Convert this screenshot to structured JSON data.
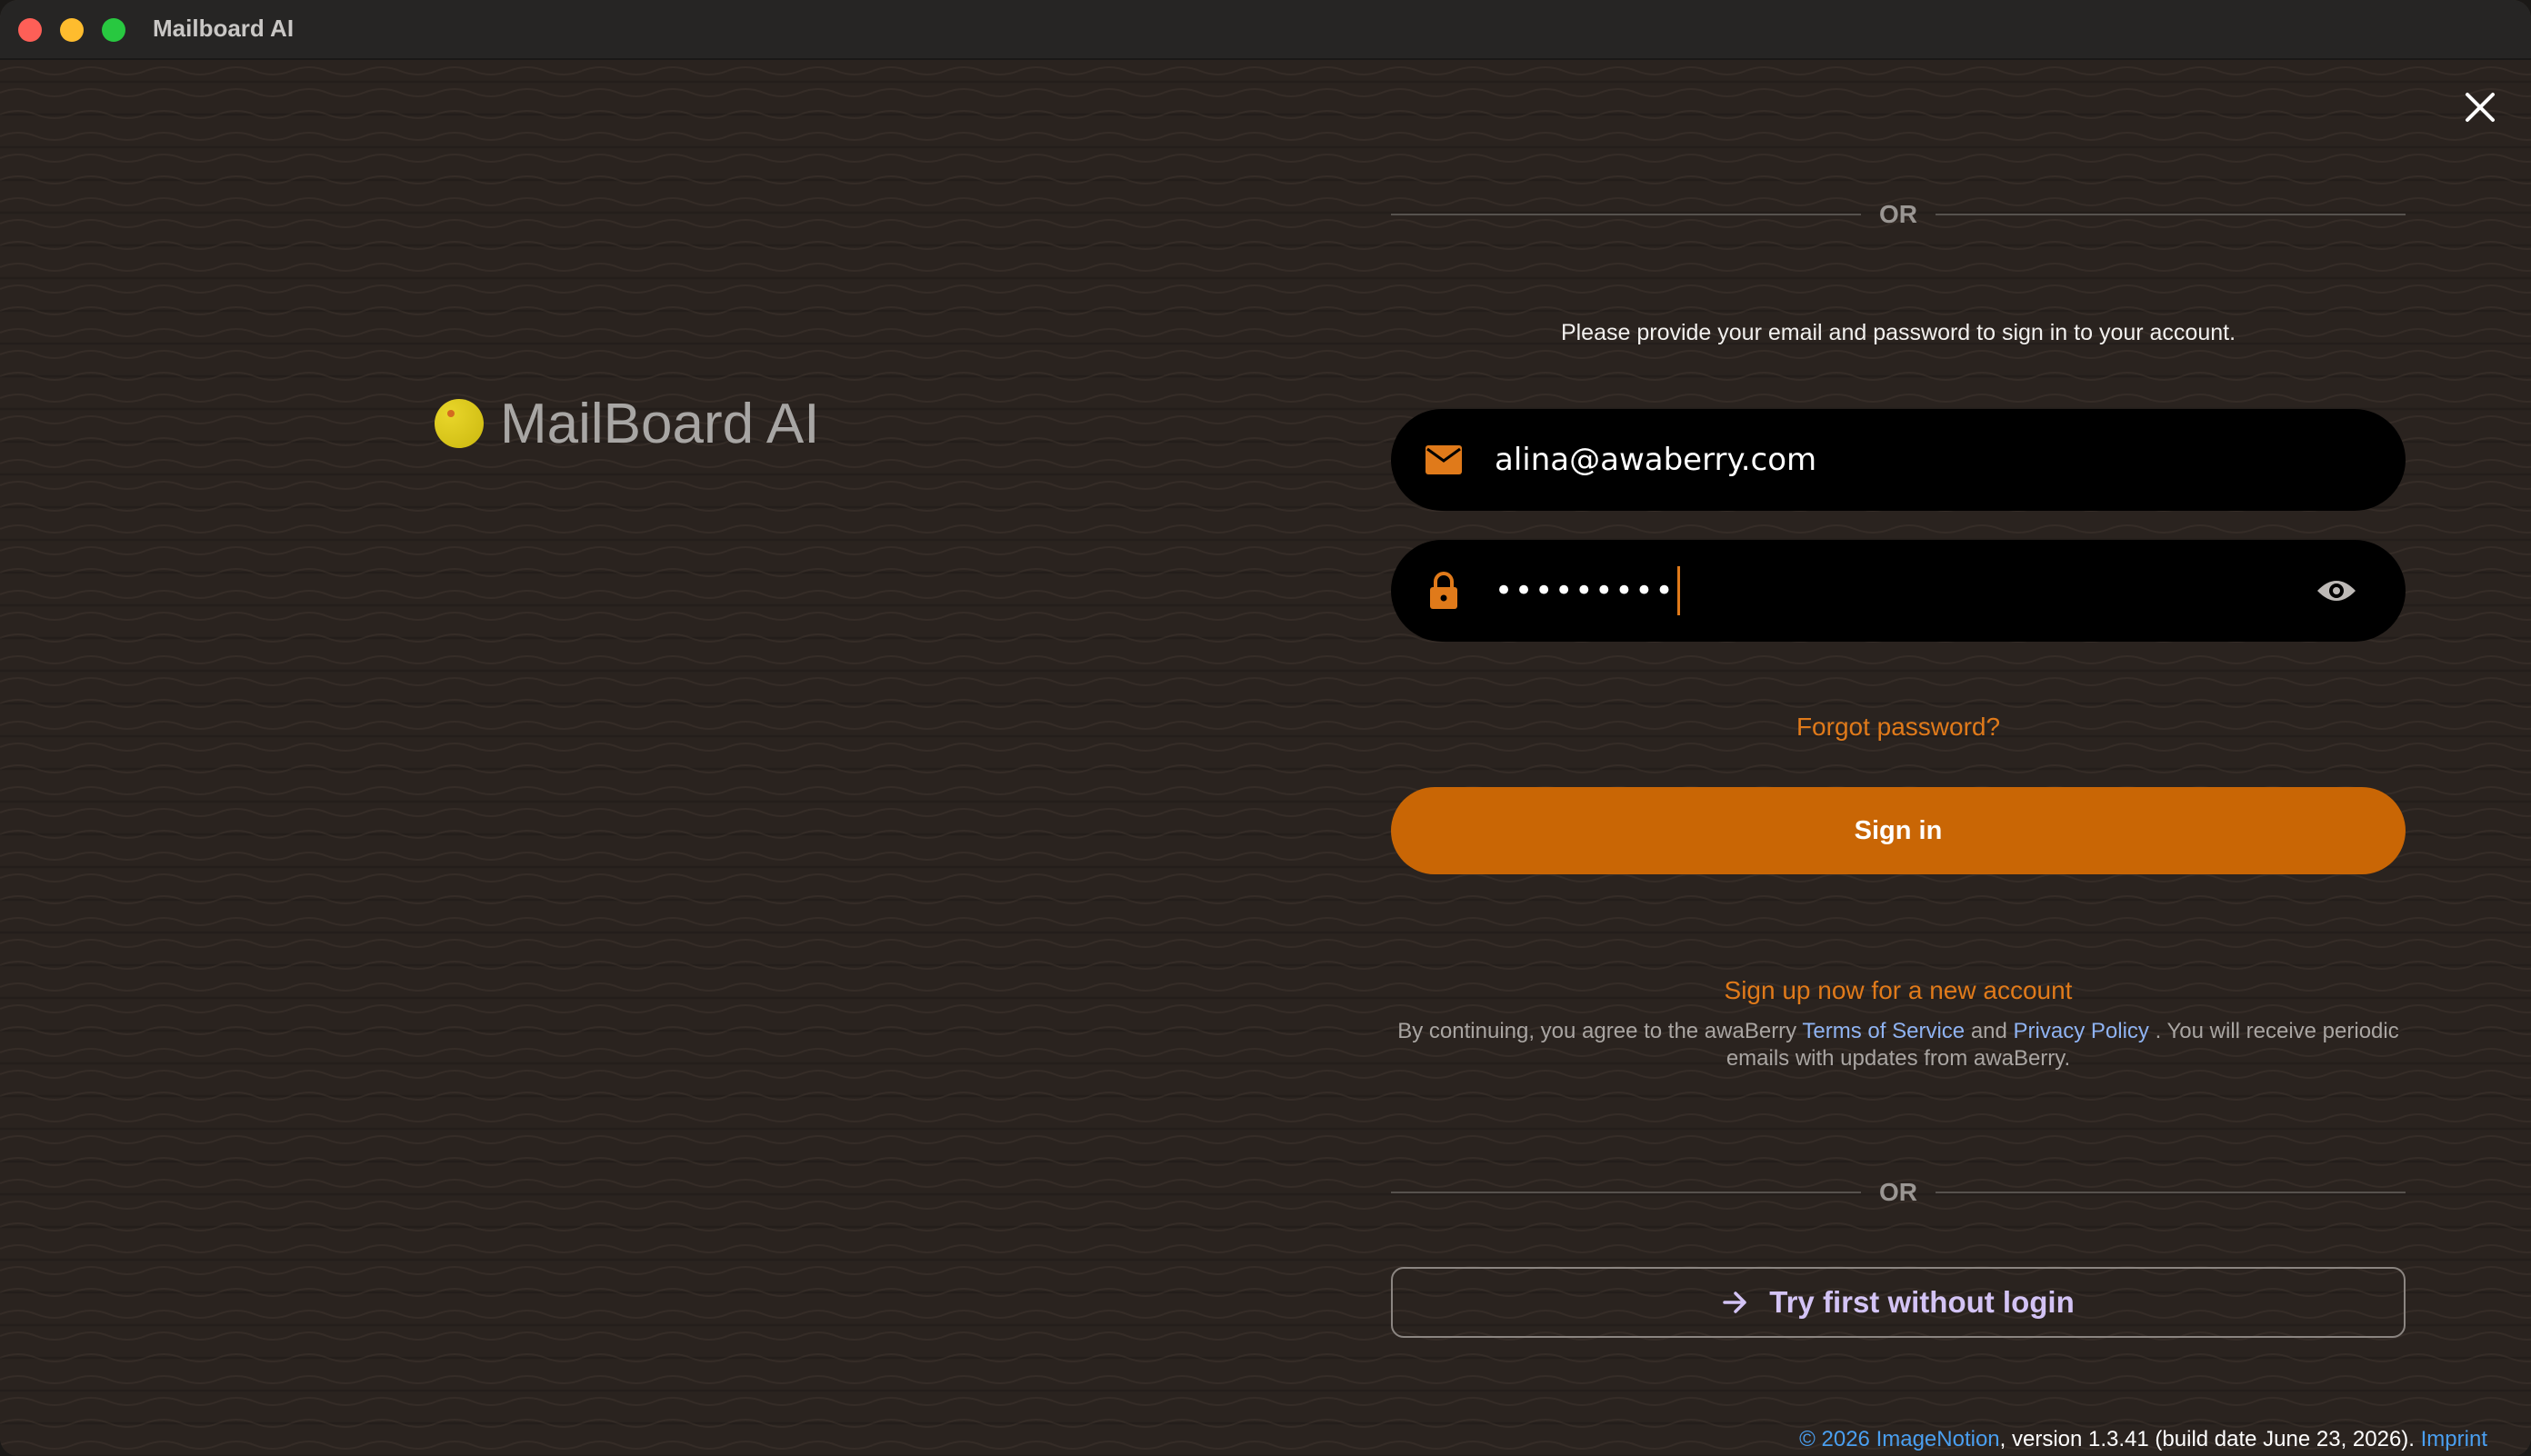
{
  "window": {
    "title": "Mailboard AI"
  },
  "brand": {
    "logo_text": "MailBoard AI",
    "accent_color": "#c96605",
    "link_color": "#e07a1a",
    "logo_dot_color": "#e9d62a"
  },
  "login": {
    "or_top": "OR",
    "instruction": "Please provide your email and password to sign in to your account.",
    "email_value": "alina@awaberry.com",
    "password_masked": "•••••••••",
    "forgot_password": "Forgot password?",
    "sign_in": "Sign in",
    "sign_up": "Sign up now for a new account",
    "legal_prefix": "By continuing, you agree to the awaBerry",
    "terms_link": "Terms of Service",
    "legal_and": "and",
    "privacy_link": "Privacy Policy",
    "legal_suffix": ". You will receive periodic emails with updates from awaBerry.",
    "or_bottom": "OR",
    "try_without_login": "Try first without login"
  },
  "footer": {
    "copyright_link": "© 2026 ImageNotion",
    "version_text": ", version 1.3.41 (build date June 23, 2026). ",
    "imprint_link": "Imprint"
  },
  "icons": {
    "close": "close-icon",
    "email": "mail-icon",
    "password": "lock-icon",
    "show_password": "eye-icon",
    "try_arrow": "arrow-right-icon"
  }
}
